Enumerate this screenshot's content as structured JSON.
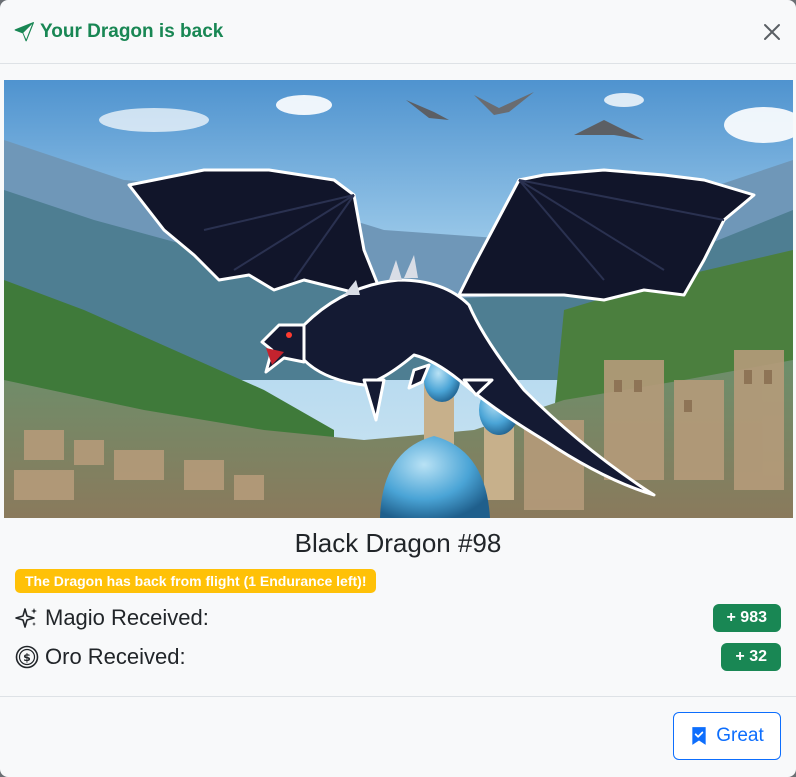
{
  "modal": {
    "title": "Your Dragon is back",
    "title_icon": "send-icon",
    "close_icon": "close-icon"
  },
  "image": {
    "description_icon": "dragon-illustration"
  },
  "dragon": {
    "name": "Black Dragon #98",
    "status_message": "The Dragon has back from flight (1 Endurance left)!"
  },
  "rewards": [
    {
      "icon": "sparkles-icon",
      "label": "Magio Received:",
      "value": "+ 983"
    },
    {
      "icon": "coin-icon",
      "label": "Oro Received:",
      "value": "+ 32"
    }
  ],
  "footer": {
    "great_label": "Great",
    "great_icon": "bookmark-check-icon"
  },
  "colors": {
    "success": "#198754",
    "warning": "#ffc107",
    "primary": "#0d6efd",
    "background": "#f8f9fa"
  }
}
